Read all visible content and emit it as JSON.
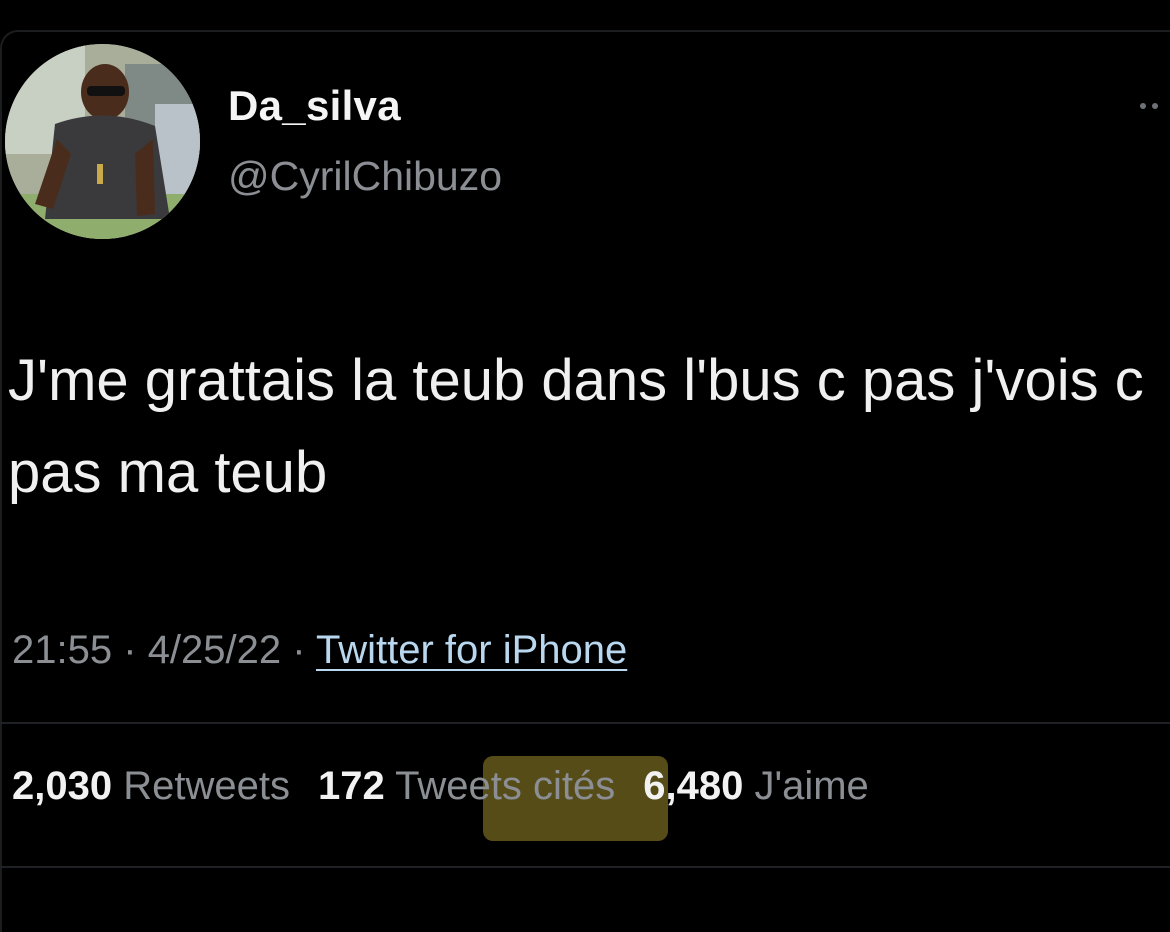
{
  "tweet": {
    "display_name": "Da_silva",
    "handle": "@CyrilChibuzo",
    "text": "J'me grattais la teub dans l'bus c pas j'vois c pas ma teub",
    "time": "21:55",
    "date": "4/25/22",
    "separator": "·",
    "source": "Twitter for iPhone"
  },
  "stats": {
    "retweets_count": "2,030",
    "retweets_label": "Retweets",
    "quotes_count": "172",
    "quotes_label_highlighted": "Tweets",
    "quotes_label_rest": "cités",
    "likes_count": "6,480",
    "likes_label": "J'aime"
  },
  "icons": {
    "more": "more-dots-icon"
  },
  "colors": {
    "background": "#000000",
    "text_primary": "#f0f0f0",
    "text_secondary": "#8b8f94",
    "link": "#b9d8ef",
    "highlight": "#8a7a26"
  }
}
